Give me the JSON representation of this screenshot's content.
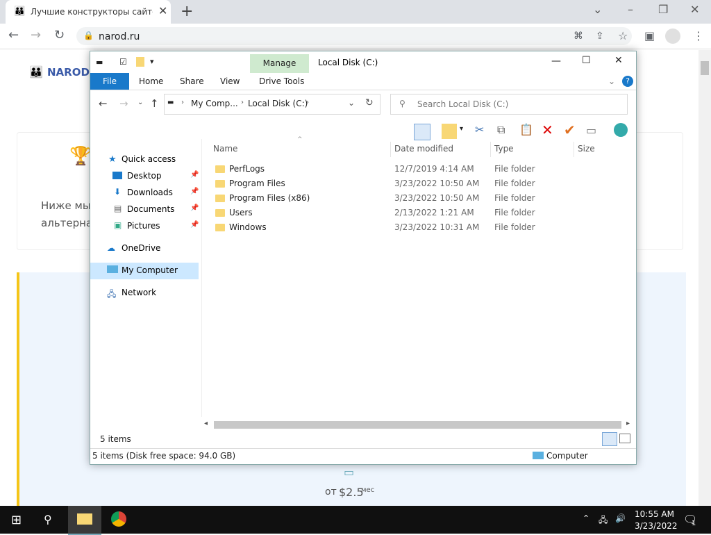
{
  "browser": {
    "tab_title": "Лучшие конструкторы сайтов |",
    "url": "narod.ru"
  },
  "page": {
    "logo_text": "NAROD",
    "card_text_1": "Ниже мы",
    "card_text_2": "альтернат",
    "price_prefix": "от",
    "price": "$2.5",
    "price_suffix": "мес"
  },
  "explorer": {
    "title": "Local Disk (C:)",
    "manage_label": "Manage",
    "ribbon_tabs": {
      "file": "File",
      "home": "Home",
      "share": "Share",
      "view": "View",
      "drive_tools": "Drive Tools"
    },
    "address": {
      "crumb1": "My Comp...",
      "crumb2": "Local Disk (C:)"
    },
    "search_placeholder": "Search Local Disk (C:)",
    "nav": {
      "quick_access": "Quick access",
      "desktop": "Desktop",
      "downloads": "Downloads",
      "documents": "Documents",
      "pictures": "Pictures",
      "onedrive": "OneDrive",
      "my_computer": "My Computer",
      "network": "Network"
    },
    "columns": {
      "name": "Name",
      "date": "Date modified",
      "type": "Type",
      "size": "Size"
    },
    "files": [
      {
        "name": "PerfLogs",
        "date": "12/7/2019 4:14 AM",
        "type": "File folder"
      },
      {
        "name": "Program Files",
        "date": "3/23/2022 10:50 AM",
        "type": "File folder"
      },
      {
        "name": "Program Files (x86)",
        "date": "3/23/2022 10:50 AM",
        "type": "File folder"
      },
      {
        "name": "Users",
        "date": "2/13/2022 1:21 AM",
        "type": "File folder"
      },
      {
        "name": "Windows",
        "date": "3/23/2022 10:31 AM",
        "type": "File folder"
      }
    ],
    "item_count": "5 items",
    "status_left": "5 items (Disk free space: 94.0 GB)",
    "status_right": "Computer"
  },
  "taskbar": {
    "time": "10:55 AM",
    "date": "3/23/2022",
    "notification_count": "1"
  }
}
